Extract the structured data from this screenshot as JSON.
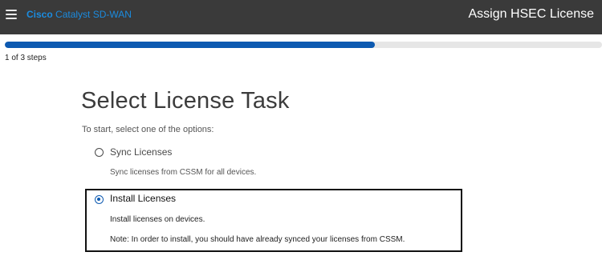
{
  "header": {
    "brand_bold": "Cisco",
    "brand_rest": " Catalyst SD-WAN",
    "page_heading": "Assign HSEC License",
    "menu_icon": "hamburger-menu-icon"
  },
  "progress": {
    "fraction": 0.62,
    "step_text": "1 of 3 steps",
    "fill_color": "#0d5ab1"
  },
  "main": {
    "title": "Select License Task",
    "instruction": "To start, select one of the options:",
    "options": [
      {
        "label": "Sync Licenses",
        "description": "Sync licenses from CSSM for all devices.",
        "selected": false
      },
      {
        "label": "Install Licenses",
        "description": "Install licenses on devices.",
        "note": "Note: In order to install, you should have already synced your licenses from CSSM.",
        "selected": true
      }
    ]
  }
}
